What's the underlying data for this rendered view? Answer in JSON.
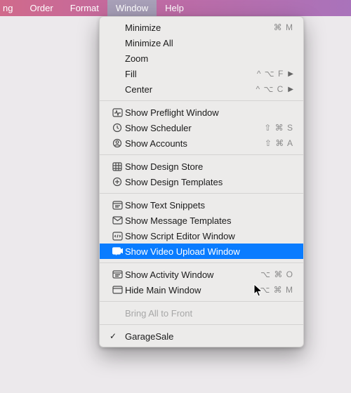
{
  "menubar": {
    "items": [
      {
        "label": "ng"
      },
      {
        "label": "Order"
      },
      {
        "label": "Format"
      },
      {
        "label": "Window",
        "selected": true
      },
      {
        "label": "Help"
      }
    ]
  },
  "menu": {
    "minimize": {
      "label": "Minimize",
      "shortcut": "⌘ M"
    },
    "minimize_all": {
      "label": "Minimize All"
    },
    "zoom": {
      "label": "Zoom"
    },
    "fill": {
      "label": "Fill",
      "shortcut": "^ ⌥ F"
    },
    "center": {
      "label": "Center",
      "shortcut": "^ ⌥ C"
    },
    "preflight": {
      "label": "Show Preflight Window"
    },
    "scheduler": {
      "label": "Show Scheduler",
      "shortcut": "⇧ ⌘ S"
    },
    "accounts": {
      "label": "Show Accounts",
      "shortcut": "⇧ ⌘ A"
    },
    "design_store": {
      "label": "Show Design Store"
    },
    "design_templates": {
      "label": "Show Design Templates"
    },
    "text_snippets": {
      "label": "Show Text Snippets"
    },
    "msg_templates": {
      "label": "Show Message Templates"
    },
    "script_editor": {
      "label": "Show Script Editor Window"
    },
    "video_upload": {
      "label": "Show Video Upload Window"
    },
    "activity": {
      "label": "Show Activity Window",
      "shortcut": "⌥ ⌘ O"
    },
    "hide_main": {
      "label": "Hide Main Window",
      "shortcut": "⌥ ⌘ M"
    },
    "bring_front": {
      "label": "Bring All to Front"
    },
    "garagesale": {
      "label": "GarageSale",
      "checked": true
    }
  }
}
